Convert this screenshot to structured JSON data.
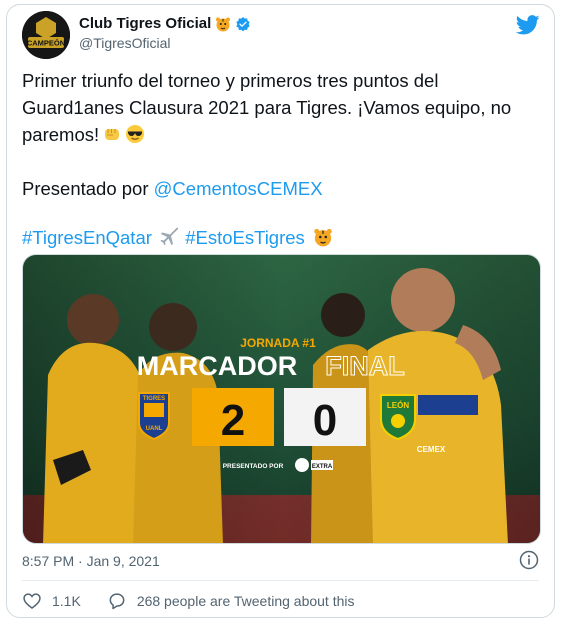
{
  "author": {
    "name": "Club Tigres Oficial",
    "handle": "@TigresOficial",
    "avatar_text": "CAMPEÓN"
  },
  "tweet": {
    "line1": "Primer triunfo del torneo y primeros tres puntos del",
    "line2": "Guard1anes Clausura 2021 para Tigres. ¡Vamos equipo, no",
    "line3": "paremos!",
    "presented_prefix": "Presentado por ",
    "mention": "@CementosCEMEX",
    "hashtag1": "#TigresEnQatar",
    "hashtag2": "#EstoEsTigres"
  },
  "graphic": {
    "jornada": "JORNADA #1",
    "title_left": "MARCADOR",
    "title_right": "FINAL",
    "home_score": "2",
    "away_score": "0",
    "home_crest_top": "TIGRES",
    "home_crest_bottom": "UANL",
    "away_crest": "LEÓN",
    "presented_by": "PRESENTADO POR",
    "sponsor_extra": "EXTRA",
    "sponsor_cemex": "CEMEX",
    "colors": {
      "gold": "#f5a800",
      "navy": "#1d3f8f",
      "green": "#1f7a3a"
    }
  },
  "meta": {
    "timestamp": "8:57 PM · Jan 9, 2021",
    "likes": "1.1K",
    "tweeting": "268 people are Tweeting about this"
  },
  "icons": {
    "brand": "twitter-bird-icon",
    "verified": "verified-badge-icon",
    "like": "heart-icon",
    "reply": "comment-icon",
    "info": "info-icon"
  }
}
